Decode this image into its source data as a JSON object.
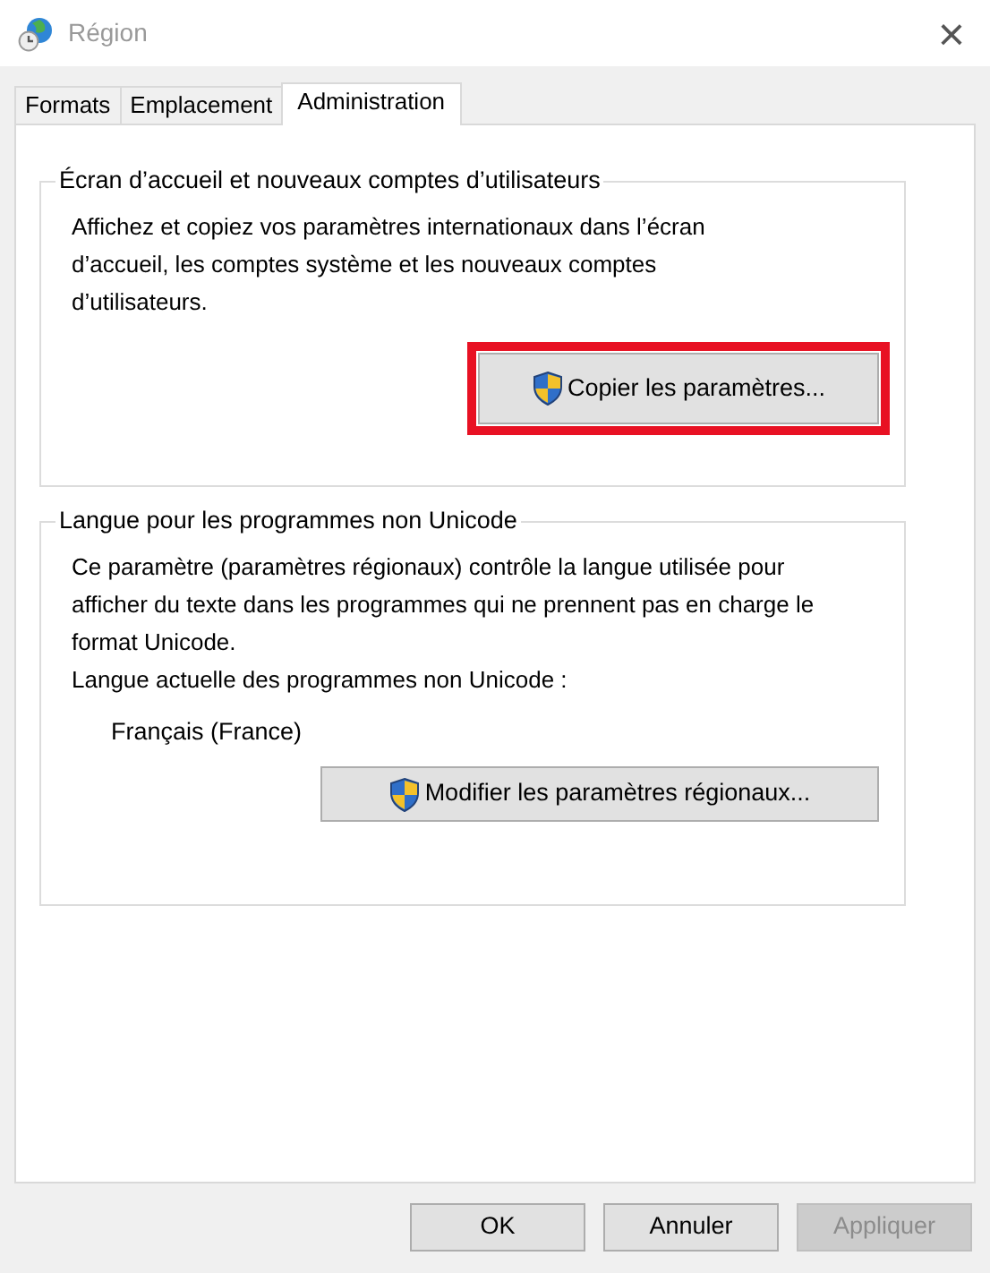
{
  "window": {
    "title": "Région",
    "close": "×"
  },
  "tabs": [
    {
      "label": "Formats",
      "selected": false
    },
    {
      "label": "Emplacement",
      "selected": false
    },
    {
      "label": "Administration",
      "selected": true
    }
  ],
  "groups": [
    {
      "title": "Écran d’accueil et nouveaux comptes d’utilisateurs",
      "texts": [
        {
          "kind": "paragraph",
          "text": "Affichez et copiez vos paramètres internationaux dans l’écran d’accueil, les comptes système et les nouveaux comptes d’utilisateurs."
        }
      ],
      "button": {
        "label": "Copier les paramètres...",
        "highlighted": true
      }
    },
    {
      "title": "Langue pour les programmes non Unicode",
      "texts": [
        {
          "kind": "paragraph",
          "text": "Ce paramètre (paramètres régionaux) contrôle la langue utilisée pour afficher du texte dans les programmes qui ne prennent pas en charge le format Unicode."
        },
        {
          "kind": "label",
          "text": "Langue actuelle des programmes non Unicode :"
        },
        {
          "kind": "value",
          "text": "Français (France)"
        }
      ],
      "button": {
        "label": "Modifier les paramètres régionaux...",
        "highlighted": false
      }
    }
  ],
  "buttons": [
    {
      "label": "OK",
      "disabled": false
    },
    {
      "label": "Annuler",
      "disabled": false
    },
    {
      "label": "Appliquer",
      "disabled": true
    }
  ]
}
